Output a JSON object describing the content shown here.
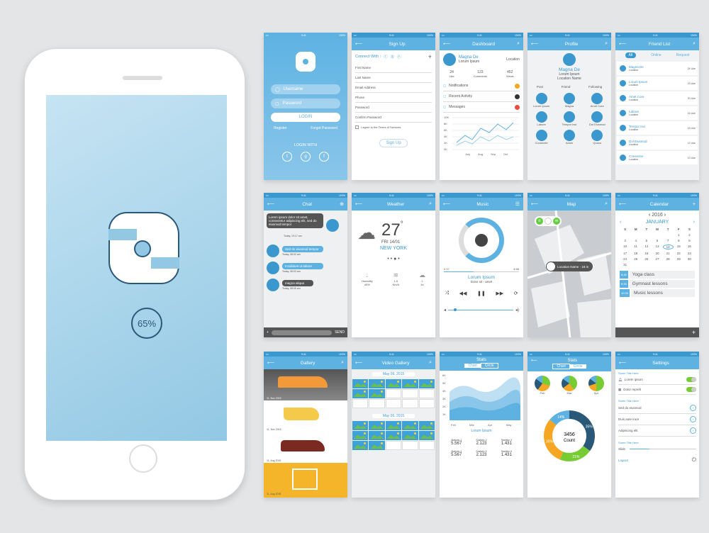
{
  "phone": {
    "progress": "65%"
  },
  "login": {
    "username": "Username",
    "password": "Password",
    "login": "LOGIN",
    "register": "Register",
    "forgot": "Forgot Password",
    "login_with": "LOGIN WITH",
    "social": [
      "t",
      "g",
      "f"
    ]
  },
  "signup": {
    "title": "Sign Up",
    "connect": "Connect With :",
    "fields": [
      "First Name",
      "Last Name",
      "Email Address",
      "Phone",
      "Password",
      "Confirm Password"
    ],
    "agree": "I agree to the Terms of Services",
    "button": "Sign Up"
  },
  "dashboard": {
    "title": "Dashboard",
    "name": "Magna De",
    "sub": "Lorum Ipsum",
    "location": "Location",
    "stats": [
      {
        "n": "24",
        "l": "Like"
      },
      {
        "n": "123",
        "l": "Comments"
      },
      {
        "n": "452",
        "l": "Views"
      }
    ],
    "items": [
      "Notifications",
      "Recent Activity",
      "Messages"
    ],
    "axis_y": [
      "10K",
      "8K",
      "6K",
      "4K",
      "2K",
      "0K"
    ],
    "axis_x": [
      "July",
      "Aug",
      "Sep",
      "Oct"
    ]
  },
  "profile": {
    "title": "Profile",
    "name": "Magna De",
    "sub": "Lorum Ipsum",
    "location": "Location Name",
    "stats": [
      "Post",
      "Friend",
      "Following"
    ],
    "people": [
      "Lorum Ipsum",
      "Magna",
      "Amet Core",
      "Labore",
      "Tempor Inci",
      "Dol Eiusmod",
      "Consecter",
      "Aduin",
      "Quous"
    ]
  },
  "friends": {
    "title": "Friend List",
    "tabs": [
      "All",
      "Online",
      "Request"
    ],
    "list": [
      [
        "Magna De",
        "24 Like"
      ],
      [
        "Lorum Ipsum",
        "23 Like"
      ],
      [
        "Amet Core",
        "20 Like"
      ],
      [
        "Labore",
        "16 Like"
      ],
      [
        "Tempor Inci",
        "15 Like"
      ],
      [
        "Dol Eiusmod",
        "12 Like"
      ],
      [
        "Consecter",
        "10 Like"
      ]
    ],
    "location": "Location"
  },
  "chat": {
    "title": "Chat",
    "msg1": "Lorem ipsum dolor sit amet, consectetur adipiscing elit, sed do eiusmod tempor",
    "t1": "Today, 10:17 am",
    "msgs": [
      "Sed do eiusmod tempor",
      "Incididunt ut labore",
      "magna aliqua"
    ],
    "times": [
      "Today, 08:02 am",
      "Today, 08:03 am",
      "Today, 08:05 am"
    ],
    "send": "SEND"
  },
  "weather": {
    "title": "Weather",
    "temp": "27",
    "deg": "°",
    "date": "FRI 14/01",
    "city": "NEW YORK",
    "details": [
      [
        "Humidity",
        "40%"
      ],
      [
        "1.5",
        "Km/h"
      ],
      [
        "1",
        "4x"
      ]
    ]
  },
  "music": {
    "title": "Music",
    "time_a": "2:17",
    "time_b": "4:56",
    "song": "Lorum Ipsum",
    "artist": "Dolor sit - amet"
  },
  "map": {
    "title": "Map",
    "label": "Location Name - 18 m"
  },
  "calendar": {
    "title": "Calendar",
    "year": "2016",
    "month": "JANUARY",
    "days": [
      "S",
      "M",
      "T",
      "W",
      "T",
      "F",
      "S"
    ],
    "dates": [
      "",
      "",
      "",
      "",
      "",
      "1",
      "2",
      "3",
      "4",
      "5",
      "6",
      "7",
      "8",
      "9",
      "10",
      "11",
      "12",
      "13",
      "14",
      "15",
      "16",
      "17",
      "18",
      "19",
      "20",
      "21",
      "22",
      "23",
      "24",
      "25",
      "26",
      "27",
      "28",
      "29",
      "30",
      "31",
      "",
      "",
      "",
      "",
      "",
      ""
    ],
    "events": [
      [
        "8:45",
        "Yoga class"
      ],
      [
        "9:35",
        "Gymnast lessons"
      ],
      [
        "10:35",
        "Music lessons"
      ]
    ]
  },
  "gallery": {
    "title": "Gallery",
    "items": [
      "11, Nov 2015",
      "11, Nov 2015",
      "11, Aug 2015",
      "11, Aug 2015"
    ]
  },
  "video": {
    "title": "Video Gallery",
    "date1": "May 06, 2015",
    "date2": "May 06, 2015"
  },
  "stats1": {
    "title": "Stats",
    "tabs": [
      "Chart",
      "Circle"
    ],
    "y": [
      "6K",
      "5K",
      "4K",
      "3K",
      "2K",
      "1K"
    ],
    "x": [
      "Feb",
      "Mar",
      "Apr",
      "May"
    ],
    "label": "Lorum Ipsum",
    "vals": [
      [
        "Statistic 1",
        "5.567"
      ],
      [
        "Statistic 2",
        "2.123"
      ],
      [
        "Statistic 3",
        "1.431"
      ],
      [
        "Statistic 4",
        "5.567"
      ],
      [
        "Statistic 5",
        "2.123"
      ],
      [
        "Statistic 6",
        "1.431"
      ]
    ]
  },
  "stats2": {
    "title": "Stats",
    "tabs": [
      "Chart",
      "Circle"
    ],
    "months": [
      "Feb",
      "Mar",
      "Apr"
    ],
    "count": "3456",
    "count_label": "Count",
    "pcts": [
      "35%",
      "21%",
      "30%",
      "14%"
    ]
  },
  "settings": {
    "title": "Settings",
    "sec1": "Some Title Here",
    "t1": "Lorem ipsum",
    "t2": "Dolor repreh",
    "sec2": "Some Title Here",
    "l1": "Sed do eiusmod",
    "l2": "Duis aute irure",
    "l3": "Adipiscing elit",
    "sec3": "Some Title Here",
    "slide": "Slide",
    "logout": "Logout"
  },
  "status": {
    "time": "9:41",
    "battery": "100%"
  }
}
